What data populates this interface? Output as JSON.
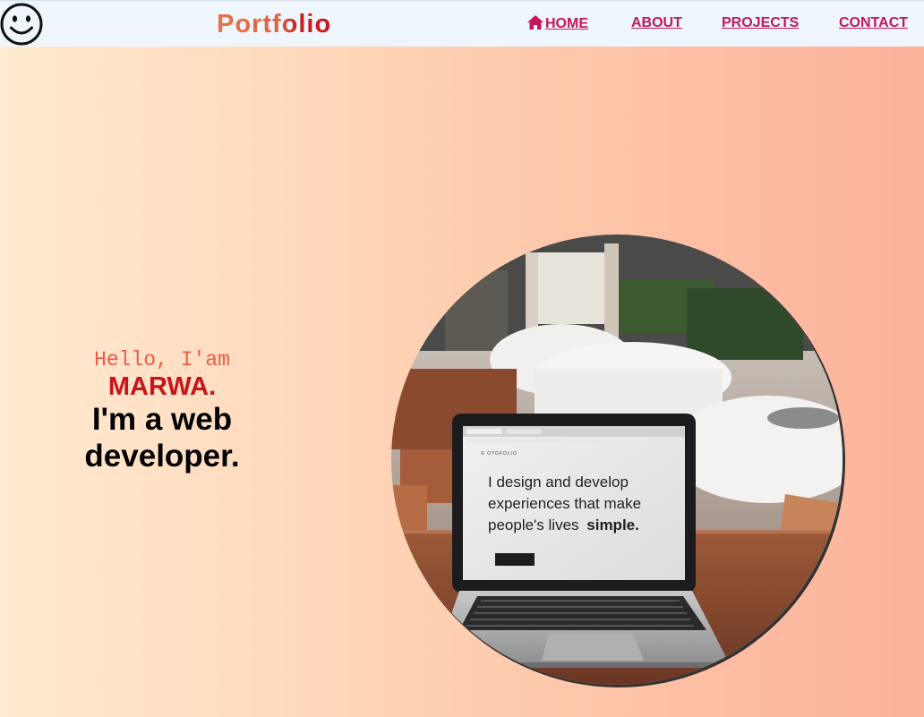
{
  "nav": {
    "logo_icon": "smiley-face-icon",
    "brand": "Portfolio",
    "home_icon": "home-icon",
    "links": {
      "home": "HOME",
      "about": "ABOUT",
      "projects": "PROJECTS",
      "contact": "CONTACT"
    }
  },
  "hero": {
    "greeting": "Hello, I'am",
    "name": "MARWA.",
    "role": "I'm a web developer."
  },
  "photo": {
    "screen_line1": "I design and develop",
    "screen_line2": "experiences that make",
    "screen_line3_prefix": "people's lives",
    "screen_line3_bold": "simple."
  },
  "colors": {
    "accent": "#c2185b",
    "brand_orange": "#e0623e",
    "brand_red": "#c8141b",
    "nav_bg": "#eef6fc"
  }
}
